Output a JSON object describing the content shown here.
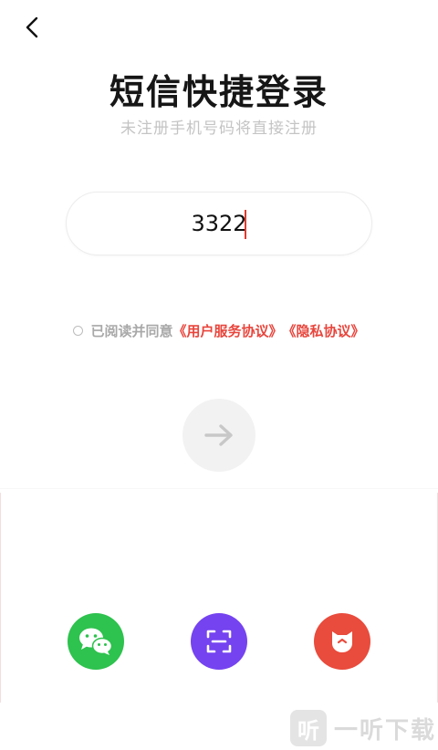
{
  "header": {
    "title": "短信快捷登录",
    "subtitle": "未注册手机号码将直接注册"
  },
  "phone": {
    "value": "3322"
  },
  "agreement": {
    "prefix": "已阅读并同意",
    "terms_link": "《用户服务协议》",
    "privacy_link": "《隐私协议》"
  },
  "social_login": {
    "items": [
      "wechat-icon",
      "scan-icon",
      "tmall-cat-icon"
    ]
  },
  "watermark": {
    "logo_glyph": "听",
    "text": "一听下载"
  },
  "colors": {
    "accent": "#e8453c",
    "wechat": "#2ec24e",
    "scan": "#7543f0",
    "tmall": "#e94b3c"
  }
}
